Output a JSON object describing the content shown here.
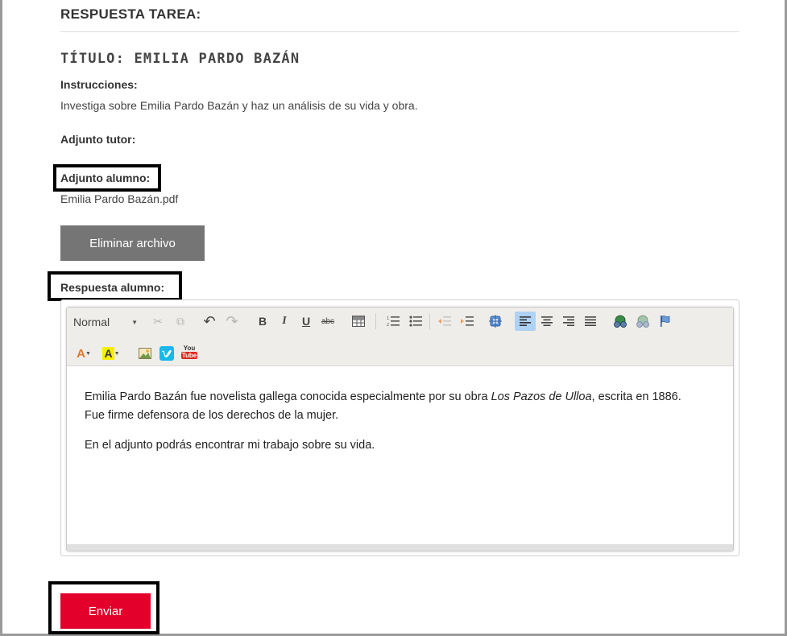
{
  "header": {
    "heading": "RESPUESTA TAREA:"
  },
  "task": {
    "title": "TÍTULO: EMILIA PARDO BAZÁN",
    "instructions_label": "Instrucciones:",
    "instructions_text": "Investiga sobre Emilia Pardo Bazán y haz un análisis de su vida y obra.",
    "tutor_attachment_label": "Adjunto tutor:",
    "student_attachment_label": "Adjunto alumno:",
    "student_attachment_file": "Emilia Pardo Bazán.pdf",
    "delete_file_label": "Eliminar archivo",
    "student_answer_label": "Respuesta alumno:"
  },
  "editor": {
    "format_select": "Normal",
    "toolbar_icons": [
      "cut-icon",
      "copy-icon",
      "undo-icon",
      "redo-icon",
      "bold-icon",
      "italic-icon",
      "underline-icon",
      "strikethrough-icon",
      "table-icon",
      "numbered-list-icon",
      "bulleted-list-icon",
      "outdent-icon",
      "indent-icon",
      "source-icon",
      "align-left-icon",
      "align-center-icon",
      "align-right-icon",
      "justify-icon",
      "link-icon",
      "unlink-icon",
      "anchor-icon",
      "text-color-icon",
      "background-color-icon",
      "image-icon",
      "vimeo-icon",
      "youtube-icon"
    ],
    "bold": "B",
    "italic": "I",
    "underline": "U",
    "strike": "abc",
    "youtube_top": "You",
    "youtube_bottom": "Tube",
    "p1_before": "Emilia Pardo Bazán fue novelista gallega conocida especialmente por su obra ",
    "p1_italic": "Los Pazos de Ulloa",
    "p1_after": ", escrita en 1886.",
    "p1_line2": "Fue firme defensora de los derechos de la mujer.",
    "p2": "En el adjunto podrás encontrar mi trabajo sobre su vida."
  },
  "actions": {
    "submit_label": "Enviar"
  },
  "colors": {
    "submit": "#e3002b",
    "delete": "#757575",
    "toolbar": "#efedea",
    "active_tool": "#aed2f3"
  }
}
